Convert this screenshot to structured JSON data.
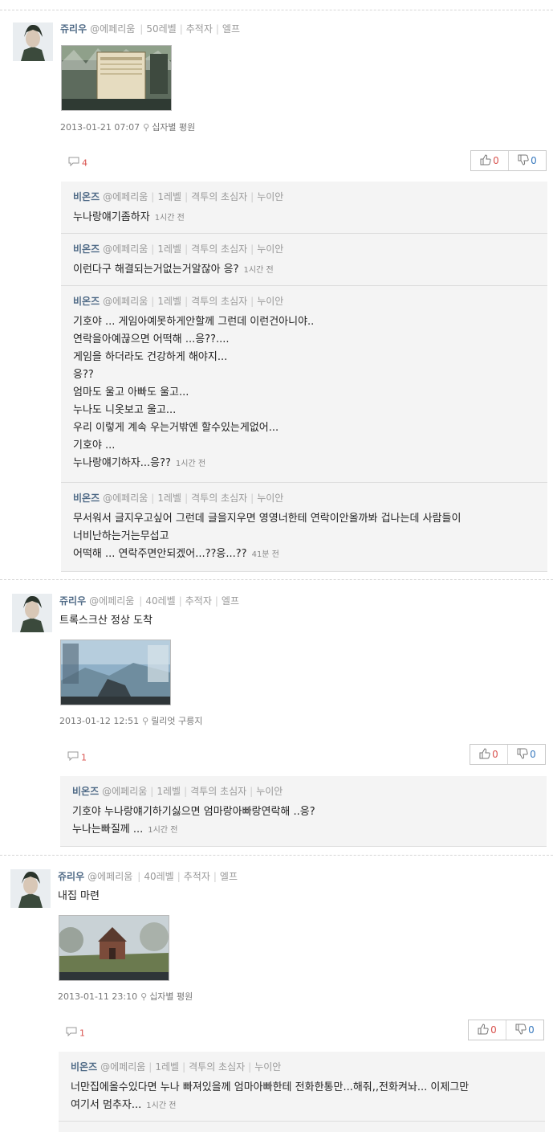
{
  "posts": [
    {
      "author": "쥬리우",
      "handle": "@에페리움",
      "level": "50레벨",
      "title": "추적자",
      "race": "엘프",
      "text": "",
      "datetime": "2013-01-21 07:07",
      "location": "십자별 평원",
      "comment_count": "4",
      "upvotes": "0",
      "downvotes": "0",
      "replies": [
        {
          "author": "비온즈",
          "handle": "@에페리움",
          "level": "1레벨",
          "title": "격투의 초심자",
          "race": "누이안",
          "lines": [
            "누나랑얘기좀하자"
          ],
          "ago": "1시간 전"
        },
        {
          "author": "비온즈",
          "handle": "@에페리움",
          "level": "1레벨",
          "title": "격투의 초심자",
          "race": "누이안",
          "lines": [
            "이런다구 해결되는거없는거알잖아 응?"
          ],
          "ago": "1시간 전"
        },
        {
          "author": "비온즈",
          "handle": "@에페리움",
          "level": "1레벨",
          "title": "격투의 초심자",
          "race": "누이안",
          "lines": [
            "기호야 ... 게임아예못하게안할께 그런데 이런건아니야..",
            "연락을아예끊으면 어떡해 ...응??....",
            "게임을 하더라도 건강하게 해야지...",
            "응??",
            "엄마도 울고 아빠도 울고...",
            "누나도 니옷보고 울고...",
            "우리 이렇게 계속 우는거밖엔 할수있는게없어...",
            "기호야 ...",
            "누나랑얘기하자...응??"
          ],
          "ago": "1시간 전"
        },
        {
          "author": "비온즈",
          "handle": "@에페리움",
          "level": "1레벨",
          "title": "격투의 초심자",
          "race": "누이안",
          "lines": [
            "무서워서 글지우고싶어 그런데 글을지우면 영영너한테 연락이안올까봐 겁나는데 사람들이",
            "너비난하는거는무섭고",
            "어떡해 ... 연락주면안되겠어...??응...??"
          ],
          "ago": "41분 전"
        }
      ]
    },
    {
      "author": "쥬리우",
      "handle": "@에페리움",
      "level": "40레벨",
      "title": "추적자",
      "race": "엘프",
      "text": "트록스크산 정상 도착",
      "datetime": "2013-01-12 12:51",
      "location": "릴리엇 구릉지",
      "comment_count": "1",
      "upvotes": "0",
      "downvotes": "0",
      "replies": [
        {
          "author": "비온즈",
          "handle": "@에페리움",
          "level": "1레벨",
          "title": "격투의 초심자",
          "race": "누이안",
          "lines": [
            "기호야 누나랑얘기하기싫으면 엄마랑아빠랑연락해 ..응?",
            "누나는빠질께 ..."
          ],
          "ago": "1시간 전"
        }
      ]
    },
    {
      "author": "쥬리우",
      "handle": "@에페리움",
      "level": "40레벨",
      "title": "추적자",
      "race": "엘프",
      "text": "내집 마련",
      "datetime": "2013-01-11 23:10",
      "location": "십자별 평원",
      "comment_count": "1",
      "upvotes": "0",
      "downvotes": "0",
      "replies": [
        {
          "author": "비온즈",
          "handle": "@에페리움",
          "level": "1레벨",
          "title": "격투의 초심자",
          "race": "누이안",
          "lines": [
            "너만집에올수있다면 누나 빠져있을께 엄마아빠한테 전화한통만...해줘,,전화켜놔... 이제그만",
            "여기서 멈추자..."
          ],
          "ago": "1시간 전"
        }
      ]
    }
  ],
  "colors": {
    "author": "#4f6a86",
    "upvote": "#d9534f",
    "downvote": "#3b7bbf",
    "thread_bg": "#f4f4f4"
  },
  "icons": {
    "comment": "speech-bubble-icon",
    "location": "map-pin-icon",
    "upvote": "thumbs-up-icon",
    "downvote": "thumbs-down-icon"
  }
}
